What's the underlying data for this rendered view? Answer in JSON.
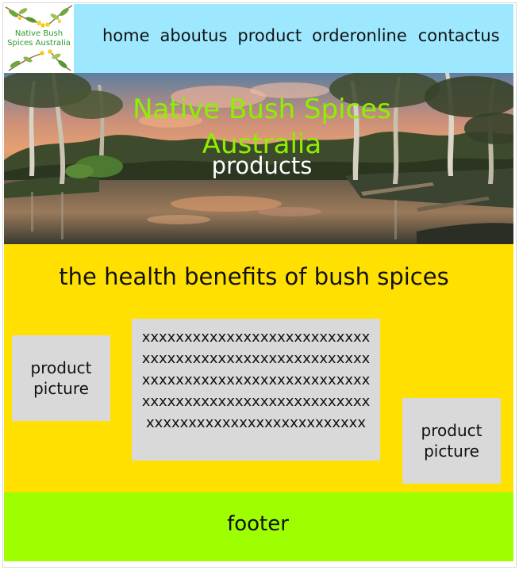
{
  "header": {
    "logo_text": "Native Bush Spices Australia",
    "nav": [
      "home",
      "aboutus",
      "product",
      "orderonline",
      "contactus"
    ]
  },
  "hero": {
    "title": "Native Bush Spices Australia",
    "subtitle": "products"
  },
  "content": {
    "heading": "the health benefits of bush spices",
    "left_picture_label": "product picture",
    "body_text": "xxxxxxxxxxxxxxxxxxxxxxxxxxxxxxxxxxxxxxxxxxxxxxxxxxxxxxxxxxxxxxxxxxxxxxxxxxxxxxxxxxxxxxxxxxxxxxxxxxxxxxxxxxxxxxxxxxxxxxxxxxxxxxxxxxxxxx",
    "right_picture_label": "product picture"
  },
  "footer": {
    "text": "footer"
  },
  "colors": {
    "header_bg": "#9ee8ff",
    "hero_title": "#8ef000",
    "content_bg": "#ffe000",
    "placeholder_bg": "#d9d9d9",
    "footer_bg": "#9dff00"
  }
}
